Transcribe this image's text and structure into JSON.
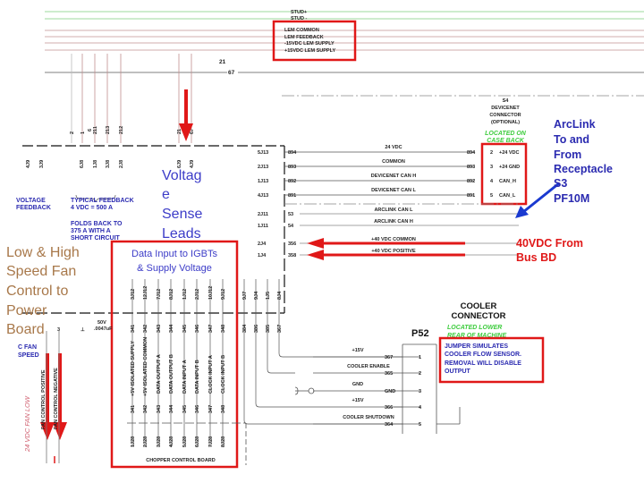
{
  "colors": {
    "highlight_red": "#e01818",
    "annotation_blue": "#3c3cc8",
    "annotation_brown": "#a8784a",
    "note_green": "#3dcc3d",
    "note_blue": "#2a2ab0"
  },
  "top": {
    "stud_pos": "STUD+",
    "stud_neg": "STUD -",
    "lem": [
      "LEM COMMON",
      "LEM FEEDBACK",
      "-15VDC LEM SUPPLY",
      "+15VDC LEM SUPPLY"
    ],
    "wire_21": "21",
    "wire_67": "67"
  },
  "feedback": {
    "wire_nums": [
      "2",
      "1",
      "6",
      "211",
      "213",
      "212"
    ],
    "connectors_left": [
      "4J9",
      "3J9"
    ],
    "connectors_mid": [
      "6J8",
      "1J8",
      "3J8",
      "2J8"
    ],
    "connectors_sense": [
      "6J9",
      "4J9"
    ],
    "sense_wires": [
      "21",
      "67"
    ],
    "voltage_feedback": [
      "VOLTAGE",
      "FEEDBACK"
    ],
    "typical": [
      "TYPICAL FEEDBACK",
      "4 VDC = 500 A",
      "",
      "FOLDS BACK TO",
      "375 A WITH A",
      "SHORT CIRCUIT"
    ]
  },
  "devicenet": {
    "title": [
      "S4",
      "DEVICENET",
      "CONNECTOR",
      "(OPTIONAL)"
    ],
    "location": [
      "LOCATED ON",
      "CASE BACK"
    ],
    "rows": [
      {
        "conn": "5J13",
        "wire": "894",
        "label": "24 VDC",
        "pin": "2",
        "pin_label": "+24 VDC"
      },
      {
        "conn": "2J13",
        "wire": "893",
        "label": "COMMON",
        "pin": "3",
        "pin_label": "+24 GND"
      },
      {
        "conn": "1J13",
        "wire": "892",
        "label": "DEVICENET CAN H",
        "pin": "4",
        "pin_label": "CAN_H"
      },
      {
        "conn": "4J13",
        "wire": "891",
        "label": "DEVICENET CAN L",
        "pin": "5",
        "pin_label": "CAN_L"
      }
    ],
    "arclink": [
      {
        "conn": "2J11",
        "wire": "53",
        "label": "ARCLINK CAN L"
      },
      {
        "conn": "1J11",
        "wire": "54",
        "label": "ARCLINK CAN H"
      }
    ],
    "bus": [
      {
        "conn": "2J4",
        "wire": "356",
        "label": "+40 VDC COMMON"
      },
      {
        "conn": "1J4",
        "wire": "358",
        "label": "+40 VDC POSITIVE"
      }
    ]
  },
  "annotations": {
    "arclink": [
      "ArcLink",
      "To and",
      "From",
      "Receptacle",
      "S3",
      "PF10M"
    ],
    "bus": [
      "40VDC From",
      "Bus BD"
    ],
    "voltage_sense": [
      "Voltag",
      "e",
      "Sense",
      "Leads"
    ],
    "fan": [
      "Low & High",
      "Speed Fan",
      "Control to",
      "Power",
      "Board"
    ],
    "igbt": [
      "Data Input to IGBTs",
      "& Supply Voltage"
    ]
  },
  "chopper": {
    "top_conns": [
      "3J12",
      "12J12",
      "7J12",
      "8J12",
      "1J12",
      "2J12",
      "10J12",
      "9J12"
    ],
    "wires": [
      "341",
      "342",
      "343",
      "344",
      "345",
      "346",
      "347",
      "348"
    ],
    "signals": [
      "+5V ISOLATED SUPPLY",
      "+5V ISOLATED COMMON",
      "DATA OUTPUT A",
      "DATA OUTPUT B",
      "DATA INPUT A",
      "DATA INPUT B",
      "CLOCK INPUT A",
      "CLOCK INPUT B"
    ],
    "bottom_conns": [
      "1J28",
      "2J28",
      "3J28",
      "4J28",
      "5J28",
      "6J28",
      "7J28",
      "8J28"
    ],
    "board": "CHOPPER CONTROL BOARD",
    "cooler_conns": [
      "9J7",
      "9J4",
      "1J5",
      "8J4"
    ],
    "cooler_wires": [
      "384",
      "386",
      "385",
      "367"
    ]
  },
  "cooler": {
    "title": [
      "COOLER",
      "CONNECTOR"
    ],
    "location": [
      "LOCATED LOWER",
      "REAR OF MACHINE"
    ],
    "plug": "P52",
    "note": [
      "JUMPER SIMULATES",
      "COOLER FLOW SENSOR.",
      "REMOVAL WILL DISABLE",
      "OUTPUT"
    ],
    "rows": [
      {
        "label": "+15V",
        "wire": "367",
        "pin": "1"
      },
      {
        "label": "COOLER ENABLE",
        "wire": "365",
        "pin": "2"
      },
      {
        "label": "GND",
        "wire": "GND",
        "pin": "3"
      },
      {
        "label": "+15V",
        "wire": "366",
        "pin": "4"
      },
      {
        "label": "COOLER SHUTDOWN",
        "wire": "364",
        "pin": "5"
      }
    ]
  },
  "fan": {
    "speed": [
      "C FAN",
      "SPEED"
    ],
    "low": "24 VDC FAN LOW",
    "pos": "FAN CONTROL POSITIVE",
    "neg": "FAN CONTROL NEGATIVE",
    "cap": [
      "50V",
      ".0047uF"
    ],
    "wire_3": "3"
  }
}
